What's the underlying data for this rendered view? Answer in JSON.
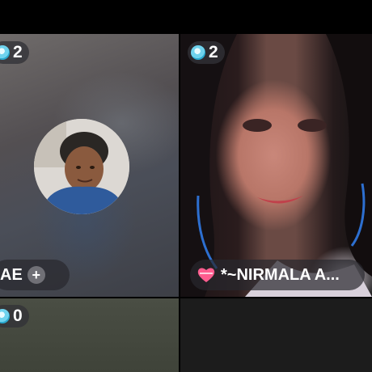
{
  "tiles": [
    {
      "id": "top-left",
      "badge_count": "2",
      "name": "AE",
      "add_symbol": "+"
    },
    {
      "id": "top-right",
      "badge_count": "2",
      "name": "*~NIRMALA A..."
    },
    {
      "id": "bottom-left",
      "badge_count": "0"
    },
    {
      "id": "bottom-right"
    }
  ],
  "colors": {
    "gem": "#2aa9cf",
    "heart": "#ff5d8f"
  },
  "icons": {
    "badge": "diamond-gem-icon",
    "name_emoji": "heart-ribbon-icon",
    "add": "plus-icon"
  }
}
